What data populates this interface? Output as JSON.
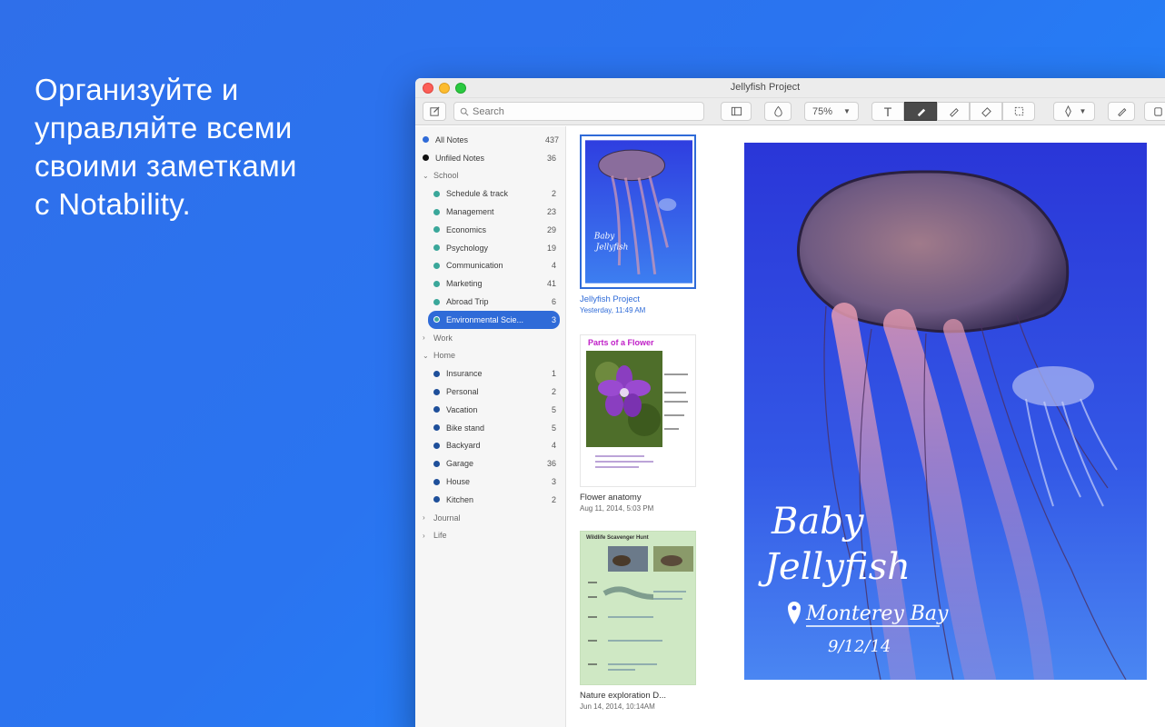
{
  "promo": {
    "headline": "Организуйте и\nуправляйте всеми\nсвоими заметками\nс Notability."
  },
  "window": {
    "title": "Jellyfish Project",
    "search_placeholder": "Search",
    "zoom": "75%",
    "text_tool_label": "T"
  },
  "sidebar": {
    "top_items": [
      {
        "label": "All Notes",
        "count": "437",
        "color": "#2f6bd8"
      },
      {
        "label": "Unfiled Notes",
        "count": "36",
        "color": "#111111"
      }
    ],
    "groups": [
      {
        "label": "School",
        "expanded": true,
        "items": [
          {
            "label": "Schedule & track",
            "count": "2",
            "color": "#3aa79a"
          },
          {
            "label": "Management",
            "count": "23",
            "color": "#3aa79a"
          },
          {
            "label": "Economics",
            "count": "29",
            "color": "#3aa79a"
          },
          {
            "label": "Psychology",
            "count": "19",
            "color": "#3aa79a"
          },
          {
            "label": "Communication",
            "count": "4",
            "color": "#3aa79a"
          },
          {
            "label": "Marketing",
            "count": "41",
            "color": "#3aa79a"
          },
          {
            "label": "Abroad Trip",
            "count": "6",
            "color": "#3aa79a"
          },
          {
            "label": "Environmental Scie...",
            "count": "3",
            "color": "#3aa79a",
            "selected": true
          }
        ]
      },
      {
        "label": "Work",
        "expanded": false,
        "items": []
      },
      {
        "label": "Home",
        "expanded": true,
        "items": [
          {
            "label": "Insurance",
            "count": "1",
            "color": "#1e4f9a"
          },
          {
            "label": "Personal",
            "count": "2",
            "color": "#1e4f9a"
          },
          {
            "label": "Vacation",
            "count": "5",
            "color": "#1e4f9a"
          },
          {
            "label": "Bike stand",
            "count": "5",
            "color": "#1e4f9a"
          },
          {
            "label": "Backyard",
            "count": "4",
            "color": "#1e4f9a"
          },
          {
            "label": "Garage",
            "count": "36",
            "color": "#1e4f9a"
          },
          {
            "label": "House",
            "count": "3",
            "color": "#1e4f9a"
          },
          {
            "label": "Kitchen",
            "count": "2",
            "color": "#1e4f9a"
          }
        ]
      },
      {
        "label": "Journal",
        "expanded": false,
        "items": []
      },
      {
        "label": "Life",
        "expanded": false,
        "items": []
      }
    ]
  },
  "notes": [
    {
      "title": "Jellyfish Project",
      "date": "Yesterday, 11:49 AM",
      "selected": true
    },
    {
      "title": "Flower anatomy",
      "date": "Aug 11, 2014, 5:03 PM",
      "heading": "Parts of a Flower"
    },
    {
      "title": "Nature exploration D...",
      "date": "Jun 14, 2014, 10:14AM",
      "heading": "Wildlife Scavenger Hunt"
    }
  ],
  "canvas": {
    "line1": "Baby",
    "line2": "Jellyfish",
    "location": "Monterey Bay",
    "date": "9/12/14"
  }
}
